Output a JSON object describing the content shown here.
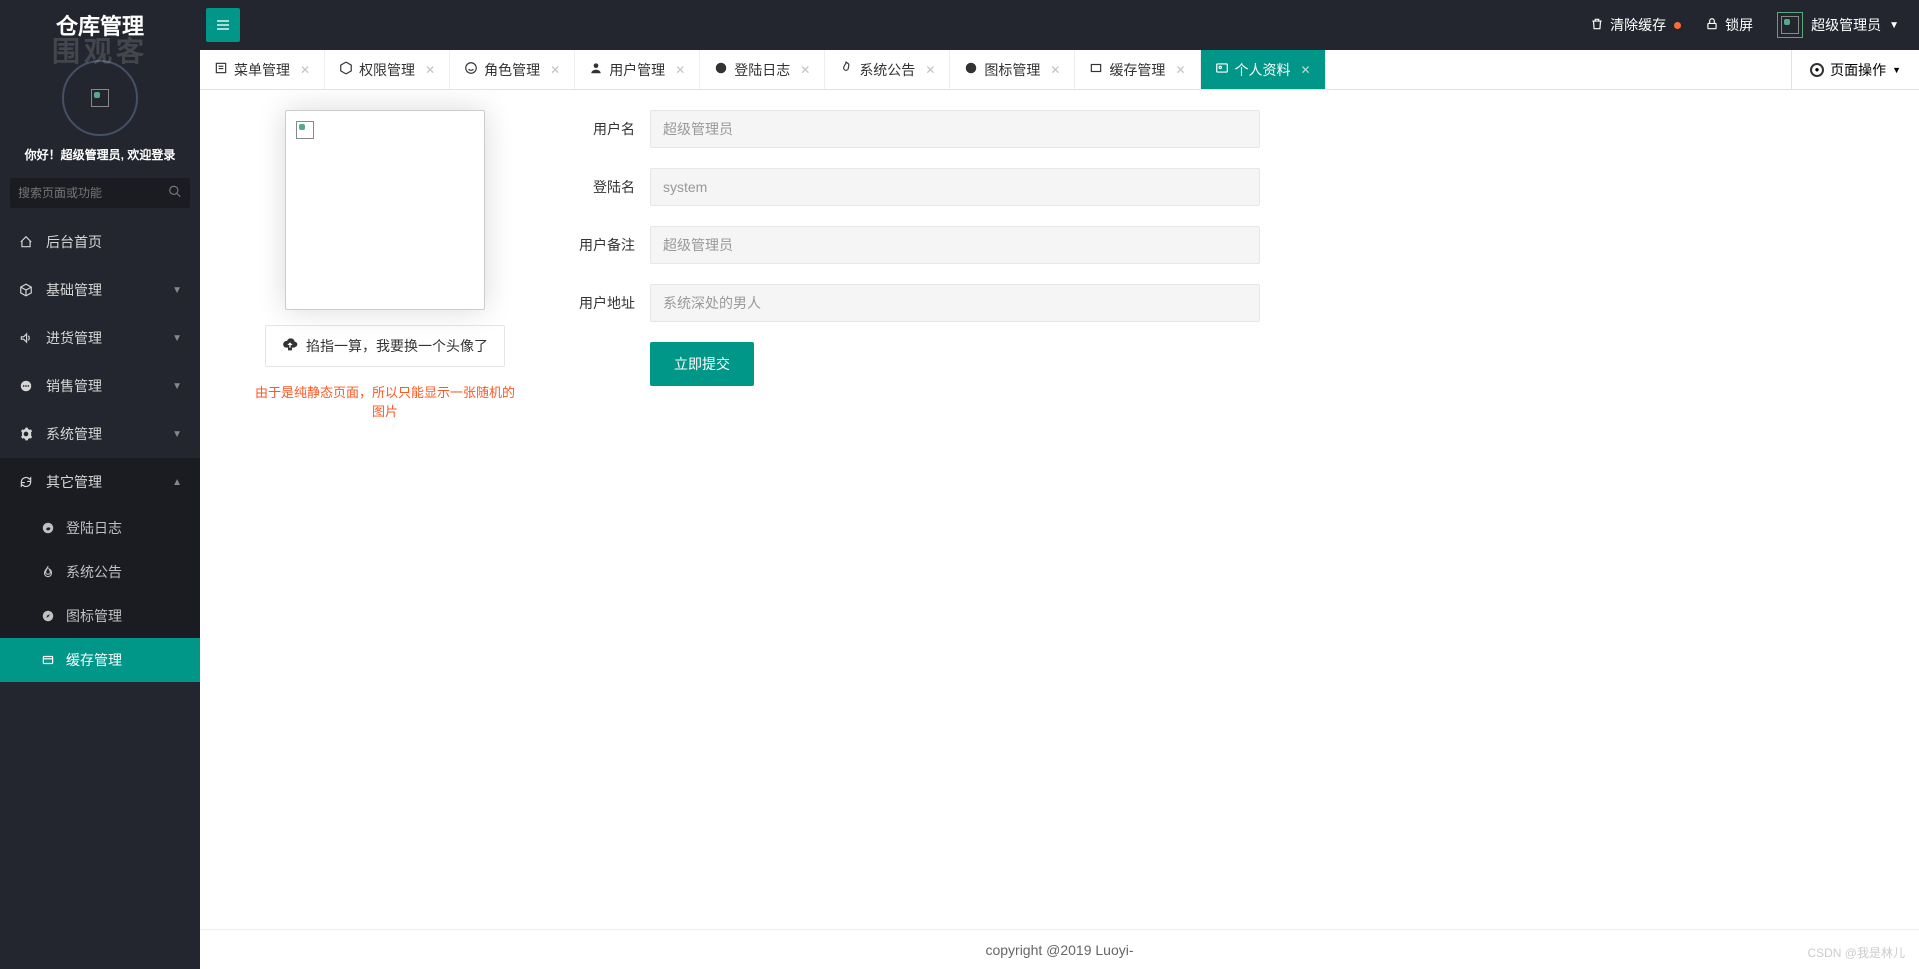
{
  "app": {
    "title": "仓库管理",
    "watermark": "围观客"
  },
  "sidebar": {
    "greeting_prefix": "你好！",
    "greeting_user": "超级管理员",
    "greeting_suffix": ", 欢迎登录",
    "search_placeholder": "搜索页面或功能",
    "nav": [
      {
        "icon": "home",
        "label": "后台首页",
        "expandable": false
      },
      {
        "icon": "cube",
        "label": "基础管理",
        "expandable": true
      },
      {
        "icon": "sound",
        "label": "进货管理",
        "expandable": true
      },
      {
        "icon": "chat",
        "label": "销售管理",
        "expandable": true
      },
      {
        "icon": "gear",
        "label": "系统管理",
        "expandable": true
      },
      {
        "icon": "refresh",
        "label": "其它管理",
        "expandable": true,
        "expanded": true
      }
    ],
    "subnav": [
      {
        "icon": "weibo",
        "label": "登陆日志"
      },
      {
        "icon": "fire",
        "label": "系统公告"
      },
      {
        "icon": "compass",
        "label": "图标管理"
      },
      {
        "icon": "cache",
        "label": "缓存管理",
        "active": true
      }
    ]
  },
  "header": {
    "clear_cache": "清除缓存",
    "lock_screen": "锁屏",
    "username": "超级管理员"
  },
  "tabs": [
    {
      "icon": "menu-list",
      "label": "菜单管理"
    },
    {
      "icon": "cube",
      "label": "权限管理"
    },
    {
      "icon": "smile",
      "label": "角色管理"
    },
    {
      "icon": "user",
      "label": "用户管理"
    },
    {
      "icon": "weibo",
      "label": "登陆日志"
    },
    {
      "icon": "fire",
      "label": "系统公告"
    },
    {
      "icon": "compass",
      "label": "图标管理"
    },
    {
      "icon": "cache",
      "label": "缓存管理"
    },
    {
      "icon": "id-card",
      "label": "个人资料",
      "active": true
    }
  ],
  "page_ops": "页面操作",
  "profile": {
    "upload_label": "掐指一算，我要换一个头像了",
    "hint": "由于是纯静态页面，所以只能显示一张随机的图片",
    "fields": {
      "username": {
        "label": "用户名",
        "value": "超级管理员"
      },
      "loginname": {
        "label": "登陆名",
        "value": "system"
      },
      "remark": {
        "label": "用户备注",
        "value": "超级管理员"
      },
      "address": {
        "label": "用户地址",
        "value": "系统深处的男人"
      }
    },
    "submit": "立即提交"
  },
  "footer": "copyright @2019 Luoyi-",
  "csdn_watermark": "CSDN @我是林儿"
}
